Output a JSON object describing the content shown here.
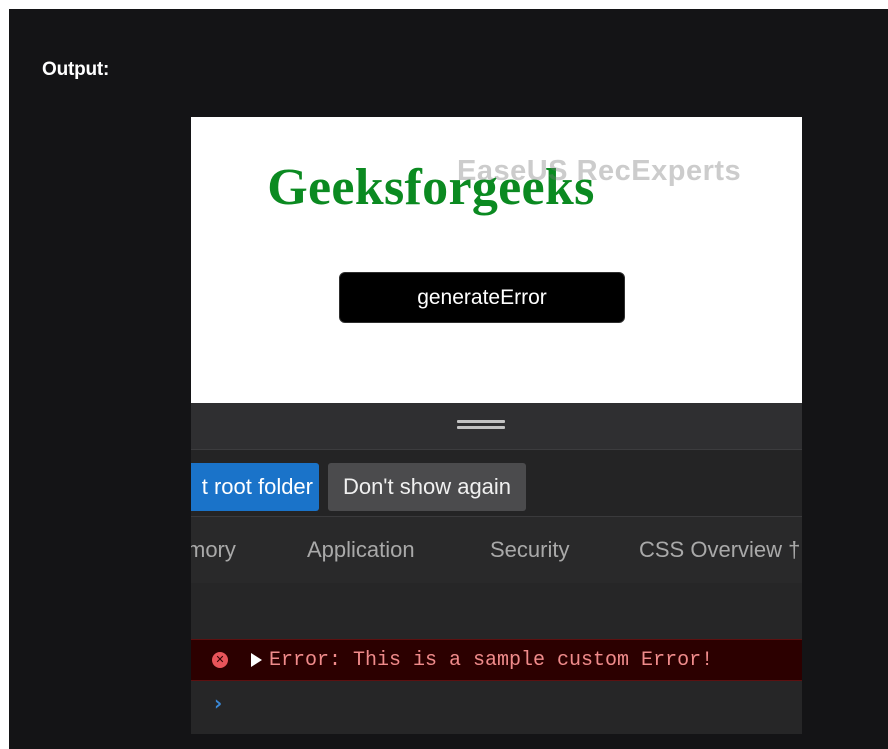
{
  "article": {
    "output_label": "Output:"
  },
  "webpage": {
    "title": "Geeksforgeeks",
    "watermark": "EaseUS RecExperts",
    "button_label": "generateError",
    "title_color": "#0b8a21"
  },
  "devtools": {
    "notice": {
      "root_folder_label": "t root folder",
      "dont_show_label": "Don't show again"
    },
    "tabs": [
      {
        "label": "mory"
      },
      {
        "label": "Application"
      },
      {
        "label": "Security"
      },
      {
        "label": "CSS Overview †"
      }
    ],
    "console": {
      "error_icon": "error-circle-icon",
      "error_message": "Error: This is a sample custom Error!",
      "error_color": "#f08b8b",
      "prompt_icon": "chevron-right-icon"
    }
  }
}
